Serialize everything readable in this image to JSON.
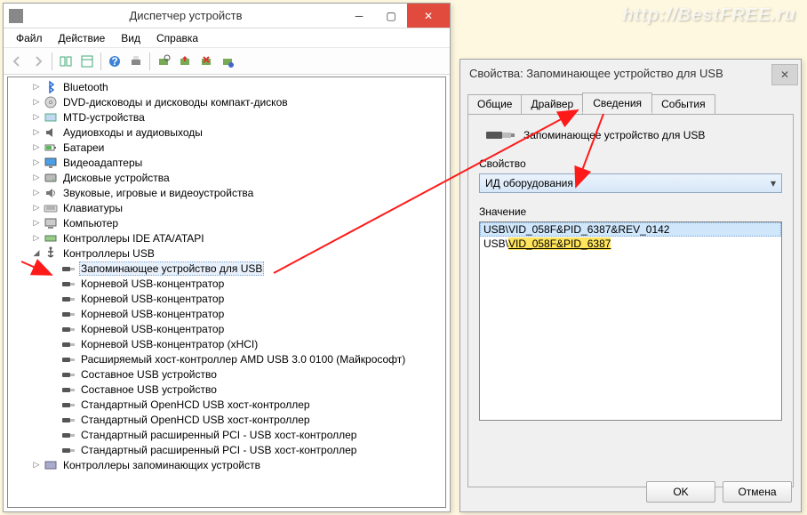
{
  "watermark": "http://BestFREE.ru",
  "devmgr": {
    "title": "Диспетчер устройств",
    "menu": [
      "Файл",
      "Действие",
      "Вид",
      "Справка"
    ],
    "tree": [
      {
        "indent": 1,
        "exp": "▷",
        "icon": "bluetooth",
        "label": "Bluetooth"
      },
      {
        "indent": 1,
        "exp": "▷",
        "icon": "disc",
        "label": "DVD-дисководы и дисководы компакт-дисков"
      },
      {
        "indent": 1,
        "exp": "▷",
        "icon": "mtd",
        "label": "MTD-устройства"
      },
      {
        "indent": 1,
        "exp": "▷",
        "icon": "audio",
        "label": "Аудиовходы и аудиовыходы"
      },
      {
        "indent": 1,
        "exp": "▷",
        "icon": "battery",
        "label": "Батареи"
      },
      {
        "indent": 1,
        "exp": "▷",
        "icon": "display",
        "label": "Видеоадаптеры"
      },
      {
        "indent": 1,
        "exp": "▷",
        "icon": "disk",
        "label": "Дисковые устройства"
      },
      {
        "indent": 1,
        "exp": "▷",
        "icon": "sound",
        "label": "Звуковые, игровые и видеоустройства"
      },
      {
        "indent": 1,
        "exp": "▷",
        "icon": "keyboard",
        "label": "Клавиатуры"
      },
      {
        "indent": 1,
        "exp": "▷",
        "icon": "computer",
        "label": "Компьютер"
      },
      {
        "indent": 1,
        "exp": "▷",
        "icon": "ide",
        "label": "Контроллеры IDE ATA/ATAPI"
      },
      {
        "indent": 1,
        "exp": "◢",
        "icon": "usb",
        "label": "Контроллеры USB"
      },
      {
        "indent": 2,
        "exp": "",
        "icon": "usbdev",
        "label": "Запоминающее устройство для USB",
        "sel": true
      },
      {
        "indent": 2,
        "exp": "",
        "icon": "usbdev",
        "label": "Корневой USB-концентратор"
      },
      {
        "indent": 2,
        "exp": "",
        "icon": "usbdev",
        "label": "Корневой USB-концентратор"
      },
      {
        "indent": 2,
        "exp": "",
        "icon": "usbdev",
        "label": "Корневой USB-концентратор"
      },
      {
        "indent": 2,
        "exp": "",
        "icon": "usbdev",
        "label": "Корневой USB-концентратор"
      },
      {
        "indent": 2,
        "exp": "",
        "icon": "usbdev",
        "label": "Корневой USB-концентратор (xHCI)"
      },
      {
        "indent": 2,
        "exp": "",
        "icon": "usbdev",
        "label": "Расширяемый хост-контроллер AMD USB 3.0 0100 (Майкрософт)"
      },
      {
        "indent": 2,
        "exp": "",
        "icon": "usbdev",
        "label": "Составное USB устройство"
      },
      {
        "indent": 2,
        "exp": "",
        "icon": "usbdev",
        "label": "Составное USB устройство"
      },
      {
        "indent": 2,
        "exp": "",
        "icon": "usbdev",
        "label": "Стандартный OpenHCD USB хост-контроллер"
      },
      {
        "indent": 2,
        "exp": "",
        "icon": "usbdev",
        "label": "Стандартный OpenHCD USB хост-контроллер"
      },
      {
        "indent": 2,
        "exp": "",
        "icon": "usbdev",
        "label": "Стандартный расширенный PCI - USB хост-контроллер"
      },
      {
        "indent": 2,
        "exp": "",
        "icon": "usbdev",
        "label": "Стандартный расширенный PCI - USB хост-контроллер"
      },
      {
        "indent": 1,
        "exp": "▷",
        "icon": "storage",
        "label": "Контроллеры запоминающих устройств"
      }
    ]
  },
  "props": {
    "title": "Свойства: Запоминающее устройство для USB",
    "tabs": [
      "Общие",
      "Драйвер",
      "Сведения",
      "События"
    ],
    "active_tab": 2,
    "device_name": "Запоминающее устройство для USB",
    "prop_label": "Свойство",
    "dropdown_value": "ИД оборудования",
    "value_label": "Значение",
    "values": [
      {
        "prefix": "USB\\",
        "rest": "VID_058F&PID_6387&REV_0142",
        "hl": false,
        "sel": true
      },
      {
        "prefix": "USB\\",
        "rest": "VID_058F&PID_6387",
        "hl": true,
        "sel": false
      }
    ],
    "ok": "OK",
    "cancel": "Отмена"
  }
}
